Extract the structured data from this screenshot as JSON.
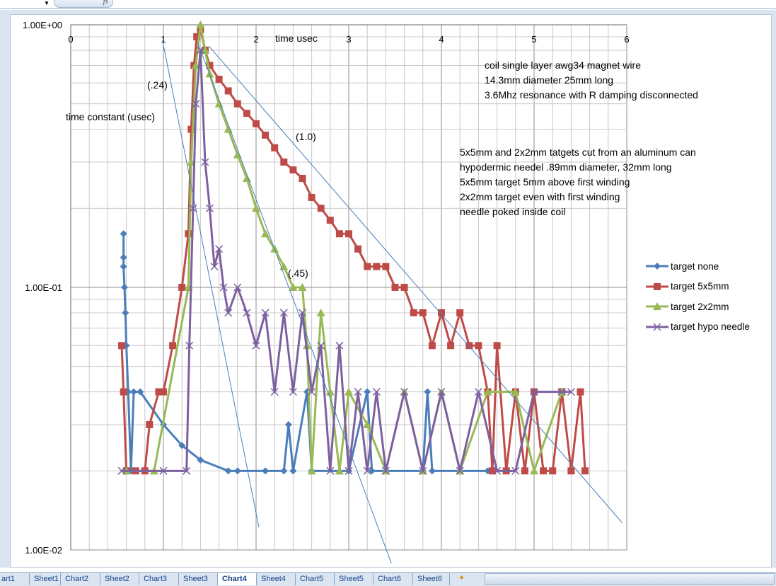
{
  "formula_bar": {
    "fx_label": "fx"
  },
  "sheet_tabs": [
    "art1",
    "Sheet1",
    "Chart2",
    "Sheet2",
    "Chart3",
    "Sheet3",
    "Chart4",
    "Sheet4",
    "Chart5",
    "Sheet5",
    "Chart6",
    "Sheet6"
  ],
  "active_tab": "Chart4",
  "colors": {
    "target_none": "#4a7ebb",
    "target_5x5": "#be4b48",
    "target_2x2": "#98b954",
    "target_hypo": "#7d60a0",
    "trend": "#4a7ebb",
    "grid": "#bfbfbf"
  },
  "chart_data": {
    "type": "scatter",
    "title": "",
    "xlabel": "time usec",
    "ylabel": "time constant (usec)",
    "xlim": [
      0,
      6
    ],
    "ylim": [
      0.01,
      1
    ],
    "yscale": "log",
    "x_ticks": [
      "0",
      "1",
      "2",
      "3",
      "4",
      "5",
      "6"
    ],
    "y_ticks": [
      "1.00E+00",
      "1.00E-01",
      "1.00E-02"
    ],
    "grid": true,
    "legend_position": "right",
    "annotations": {
      "tc1": "(.24)",
      "tc2": "(1.0)",
      "tc3": "(.45)",
      "notes1": [
        "coil   single layer awg34 magnet wire",
        "14.3mm diameter 25mm long",
        "3.6Mhz resonance with R damping disconnected"
      ],
      "notes2": [
        "5x5mm and 2x2mm tatgets cut from an aluminum can",
        "hypodermic needel  .89mm diameter, 32mm long",
        "5x5mm target 5mm above first winding",
        "2x2mm target even with first winding",
        "needle poked inside coil"
      ]
    },
    "series": [
      {
        "name": "target none",
        "marker": "diamond",
        "points": [
          [
            0.57,
            0.16
          ],
          [
            0.57,
            0.13
          ],
          [
            0.57,
            0.12
          ],
          [
            0.58,
            0.1
          ],
          [
            0.59,
            0.08
          ],
          [
            0.6,
            0.06
          ],
          [
            0.62,
            0.04
          ],
          [
            0.65,
            0.02
          ],
          [
            0.68,
            0.04
          ],
          [
            0.75,
            0.04
          ],
          [
            1.0,
            0.03
          ],
          [
            1.2,
            0.025
          ],
          [
            1.4,
            0.022
          ],
          [
            1.7,
            0.02
          ],
          [
            1.8,
            0.02
          ],
          [
            2.1,
            0.02
          ],
          [
            2.3,
            0.02
          ],
          [
            2.35,
            0.03
          ],
          [
            2.4,
            0.02
          ],
          [
            2.55,
            0.04
          ],
          [
            2.6,
            0.02
          ],
          [
            3.0,
            0.02
          ],
          [
            3.2,
            0.04
          ],
          [
            3.25,
            0.02
          ],
          [
            3.8,
            0.02
          ],
          [
            3.85,
            0.04
          ],
          [
            3.9,
            0.02
          ],
          [
            4.5,
            0.02
          ]
        ]
      },
      {
        "name": "target 5x5mm",
        "marker": "square",
        "points": [
          [
            0.55,
            0.06
          ],
          [
            0.57,
            0.04
          ],
          [
            0.6,
            0.02
          ],
          [
            0.7,
            0.02
          ],
          [
            0.8,
            0.02
          ],
          [
            0.85,
            0.03
          ],
          [
            0.95,
            0.04
          ],
          [
            1.0,
            0.04
          ],
          [
            1.1,
            0.06
          ],
          [
            1.2,
            0.1
          ],
          [
            1.27,
            0.16
          ],
          [
            1.3,
            0.4
          ],
          [
            1.33,
            0.7
          ],
          [
            1.36,
            0.9
          ],
          [
            1.4,
            0.96
          ],
          [
            1.45,
            0.8
          ],
          [
            1.5,
            0.7
          ],
          [
            1.6,
            0.62
          ],
          [
            1.7,
            0.56
          ],
          [
            1.8,
            0.5
          ],
          [
            1.9,
            0.46
          ],
          [
            2.0,
            0.42
          ],
          [
            2.1,
            0.38
          ],
          [
            2.2,
            0.34
          ],
          [
            2.3,
            0.3
          ],
          [
            2.4,
            0.28
          ],
          [
            2.5,
            0.26
          ],
          [
            2.6,
            0.22
          ],
          [
            2.7,
            0.2
          ],
          [
            2.8,
            0.18
          ],
          [
            2.9,
            0.16
          ],
          [
            3.0,
            0.16
          ],
          [
            3.1,
            0.14
          ],
          [
            3.2,
            0.12
          ],
          [
            3.3,
            0.12
          ],
          [
            3.4,
            0.12
          ],
          [
            3.5,
            0.1
          ],
          [
            3.6,
            0.1
          ],
          [
            3.7,
            0.08
          ],
          [
            3.8,
            0.08
          ],
          [
            3.9,
            0.06
          ],
          [
            4.0,
            0.08
          ],
          [
            4.1,
            0.06
          ],
          [
            4.2,
            0.08
          ],
          [
            4.3,
            0.06
          ],
          [
            4.4,
            0.06
          ],
          [
            4.5,
            0.04
          ],
          [
            4.55,
            0.02
          ],
          [
            4.6,
            0.06
          ],
          [
            4.7,
            0.02
          ],
          [
            4.8,
            0.04
          ],
          [
            4.9,
            0.02
          ],
          [
            5.0,
            0.04
          ],
          [
            5.1,
            0.02
          ],
          [
            5.2,
            0.02
          ],
          [
            5.3,
            0.04
          ],
          [
            5.4,
            0.02
          ],
          [
            5.5,
            0.04
          ],
          [
            5.55,
            0.02
          ]
        ]
      },
      {
        "name": "target 2x2mm",
        "marker": "triangle",
        "points": [
          [
            0.6,
            0.02
          ],
          [
            0.9,
            0.02
          ],
          [
            1.27,
            0.1
          ],
          [
            1.3,
            0.3
          ],
          [
            1.35,
            0.7
          ],
          [
            1.4,
            1.0
          ],
          [
            1.45,
            0.8
          ],
          [
            1.5,
            0.65
          ],
          [
            1.6,
            0.5
          ],
          [
            1.7,
            0.4
          ],
          [
            1.8,
            0.32
          ],
          [
            1.9,
            0.26
          ],
          [
            2.0,
            0.2
          ],
          [
            2.1,
            0.16
          ],
          [
            2.2,
            0.14
          ],
          [
            2.3,
            0.12
          ],
          [
            2.4,
            0.1
          ],
          [
            2.5,
            0.1
          ],
          [
            2.55,
            0.06
          ],
          [
            2.6,
            0.02
          ],
          [
            2.7,
            0.08
          ],
          [
            2.8,
            0.04
          ],
          [
            2.9,
            0.02
          ],
          [
            3.0,
            0.04
          ],
          [
            3.2,
            0.03
          ],
          [
            3.4,
            0.02
          ],
          [
            3.6,
            0.04
          ],
          [
            3.8,
            0.02
          ],
          [
            4.0,
            0.04
          ],
          [
            4.2,
            0.02
          ],
          [
            4.5,
            0.04
          ],
          [
            4.8,
            0.04
          ],
          [
            5.0,
            0.02
          ],
          [
            5.3,
            0.04
          ]
        ]
      },
      {
        "name": "target hypo needle",
        "marker": "x",
        "points": [
          [
            0.55,
            0.02
          ],
          [
            1.0,
            0.02
          ],
          [
            1.25,
            0.02
          ],
          [
            1.28,
            0.06
          ],
          [
            1.32,
            0.2
          ],
          [
            1.35,
            0.5
          ],
          [
            1.4,
            0.8
          ],
          [
            1.45,
            0.3
          ],
          [
            1.5,
            0.2
          ],
          [
            1.55,
            0.12
          ],
          [
            1.6,
            0.14
          ],
          [
            1.65,
            0.1
          ],
          [
            1.7,
            0.08
          ],
          [
            1.8,
            0.1
          ],
          [
            1.9,
            0.08
          ],
          [
            2.0,
            0.06
          ],
          [
            2.1,
            0.08
          ],
          [
            2.2,
            0.04
          ],
          [
            2.3,
            0.08
          ],
          [
            2.4,
            0.04
          ],
          [
            2.5,
            0.08
          ],
          [
            2.6,
            0.04
          ],
          [
            2.7,
            0.06
          ],
          [
            2.8,
            0.02
          ],
          [
            2.9,
            0.06
          ],
          [
            3.0,
            0.02
          ],
          [
            3.1,
            0.04
          ],
          [
            3.2,
            0.02
          ],
          [
            3.3,
            0.04
          ],
          [
            3.4,
            0.02
          ],
          [
            3.6,
            0.04
          ],
          [
            3.8,
            0.02
          ],
          [
            4.0,
            0.04
          ],
          [
            4.2,
            0.02
          ],
          [
            4.4,
            0.04
          ],
          [
            4.6,
            0.02
          ],
          [
            4.8,
            0.02
          ],
          [
            5.0,
            0.04
          ],
          [
            5.3,
            0.04
          ],
          [
            5.4,
            0.04
          ]
        ]
      }
    ],
    "trendlines": [
      {
        "label": "(.24)",
        "from": [
          0.99,
          0.873
        ],
        "to": [
          2.03,
          0.0122
        ]
      },
      {
        "label": "(.45)",
        "from": [
          1.37,
          0.857
        ],
        "to": [
          3.46,
          0.0089
        ]
      },
      {
        "label": "(1.0)",
        "from": [
          1.49,
          0.83
        ],
        "to": [
          5.95,
          0.0127
        ]
      }
    ]
  }
}
